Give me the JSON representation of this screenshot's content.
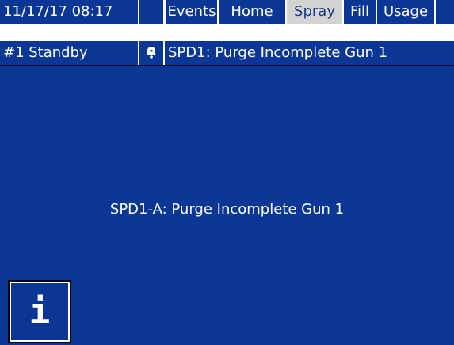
{
  "status_bar": {
    "datetime": "11/17/17 08:17",
    "tabs": [
      {
        "label": "Events",
        "active": false
      },
      {
        "label": "Home",
        "active": false
      },
      {
        "label": "Spray",
        "active": true
      },
      {
        "label": "Fill",
        "active": false
      },
      {
        "label": "Usage",
        "active": false
      }
    ]
  },
  "info_bar": {
    "system_status": "#1 Standby",
    "alarm_icon": "bell-icon",
    "alarm_text": "SPD1: Purge Incomplete Gun 1"
  },
  "main": {
    "message": "SPD1-A: Purge Incomplete Gun 1",
    "info_button_glyph": "i"
  },
  "colors": {
    "background": "#0a3796",
    "active_tab": "#d3d3d3",
    "text": "#ffffff"
  }
}
